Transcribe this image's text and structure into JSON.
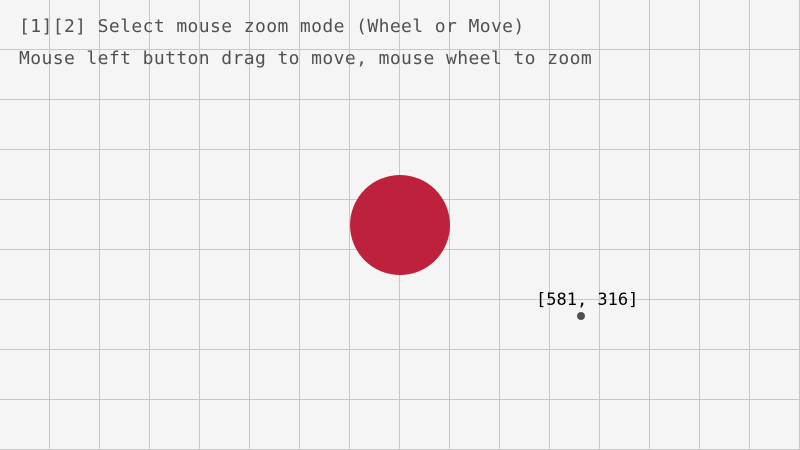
{
  "instructions": {
    "line1": "[1][2] Select mouse zoom mode (Wheel or Move)",
    "line2": "Mouse left button drag to move, mouse wheel to zoom"
  },
  "cursor": {
    "readout": "[581, 316]"
  },
  "colors": {
    "background": "#f5f5f5",
    "grid_line": "#c8c8c8",
    "text": "#505050",
    "circle_fill": "#be213b",
    "cursor_dot": "#505050",
    "readout_text": "#000000"
  }
}
